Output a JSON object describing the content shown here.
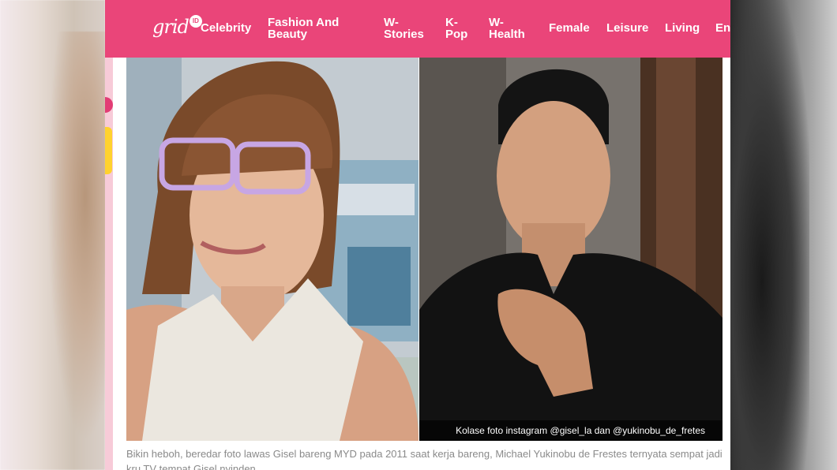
{
  "logo": {
    "text": "grid",
    "badge": "ID"
  },
  "nav": {
    "items": [
      {
        "line1": "Celebrity",
        "line2": ""
      },
      {
        "line1": "Fashion And",
        "line2": "Beauty"
      },
      {
        "line1": "W-",
        "line2": "Stories"
      },
      {
        "line1": "K-",
        "line2": "Pop"
      },
      {
        "line1": "W-",
        "line2": "Health"
      },
      {
        "line1": "Female",
        "line2": ""
      },
      {
        "line1": "Leisure",
        "line2": ""
      },
      {
        "line1": "Living",
        "line2": ""
      },
      {
        "line1": "En",
        "line2": ""
      }
    ]
  },
  "article": {
    "photo_credit": "Kolase foto instagram @gisel_la dan @yukinobu_de_fretes",
    "caption": "Bikin heboh, beredar foto lawas Gisel bareng MYD pada 2011 saat kerja bareng, Michael Yukinobu de Frestes ternyata sempat jadi kru TV tempat Gisel nyinden"
  },
  "colors": {
    "navbar": "#ea4579",
    "nav_text": "#ffffff",
    "caption_text": "#8a8a8a"
  }
}
